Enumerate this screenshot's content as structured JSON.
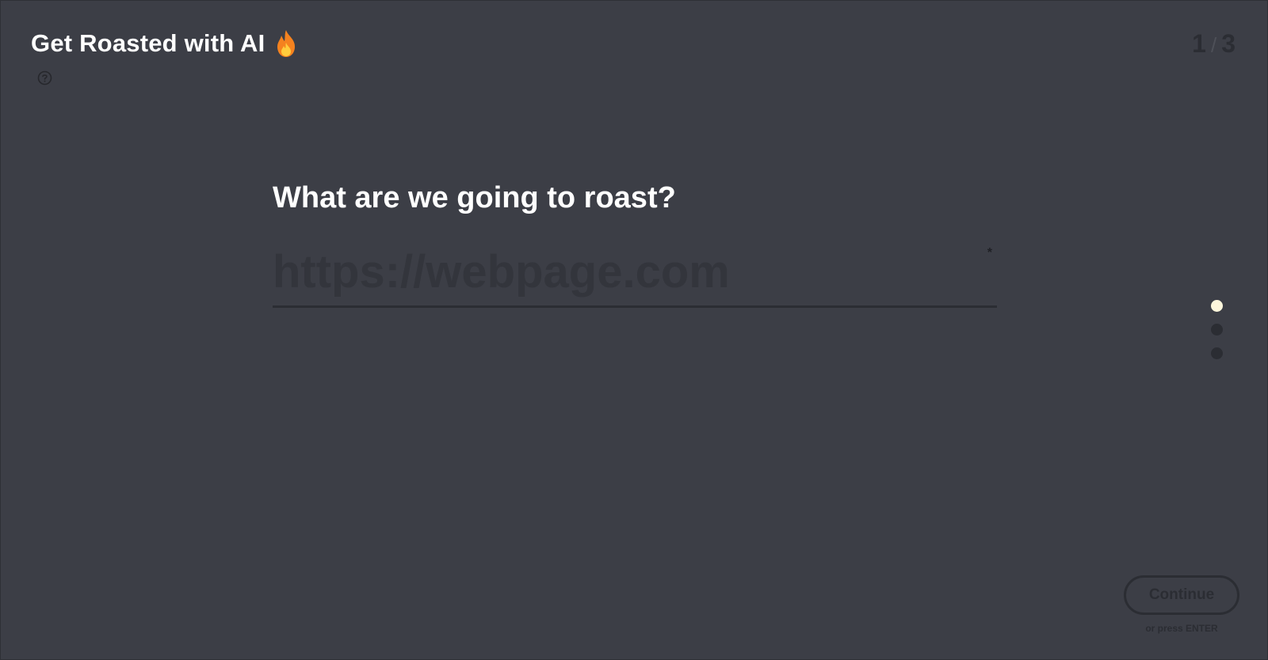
{
  "header": {
    "title": "Get Roasted with AI",
    "title_icon": "fire-icon",
    "help_icon": "question-circle-icon"
  },
  "progress": {
    "current": "1",
    "separator": "/",
    "total": "3"
  },
  "question": {
    "text": "What are we going to roast?",
    "input_placeholder": "https://webpage.com",
    "input_value": "",
    "required_mark": "*"
  },
  "step_dots": {
    "count": 3,
    "active_index": 0
  },
  "footer": {
    "continue_label": "Continue",
    "enter_hint": "or press ENTER"
  },
  "colors": {
    "background": "#3c3e46",
    "text": "#ffffff",
    "muted": "#2b2d33",
    "active_dot": "#fdf6dc",
    "fire": "#f5821f"
  }
}
